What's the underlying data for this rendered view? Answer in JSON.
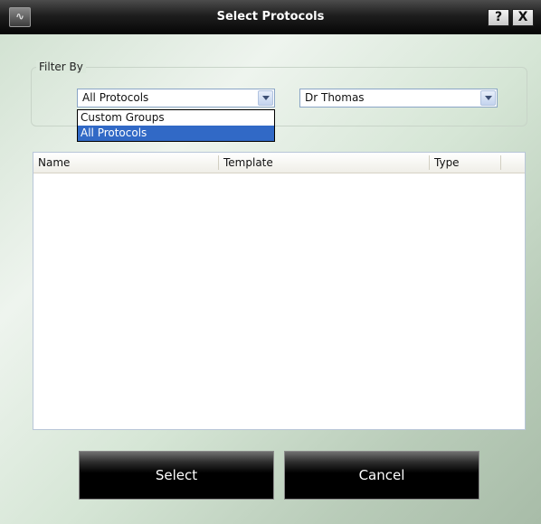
{
  "window": {
    "title": "Select Protocols",
    "app_icon_glyph": "∿",
    "help_glyph": "?",
    "close_glyph": "X"
  },
  "filter": {
    "legend": "Filter By",
    "protocol_combo": {
      "value": "All Protocols"
    },
    "doctor_combo": {
      "value": "Dr Thomas"
    },
    "dropdown_options": [
      {
        "label": "Custom Groups",
        "selected": false
      },
      {
        "label": "All Protocols",
        "selected": true
      }
    ]
  },
  "table": {
    "columns": [
      "Name",
      "Template",
      "Type"
    ],
    "rows": []
  },
  "buttons": {
    "select_label": "Select",
    "cancel_label": "Cancel"
  },
  "colors": {
    "title_bar": "#050505",
    "selection": "#3169c6",
    "button_bg": "#000000"
  }
}
